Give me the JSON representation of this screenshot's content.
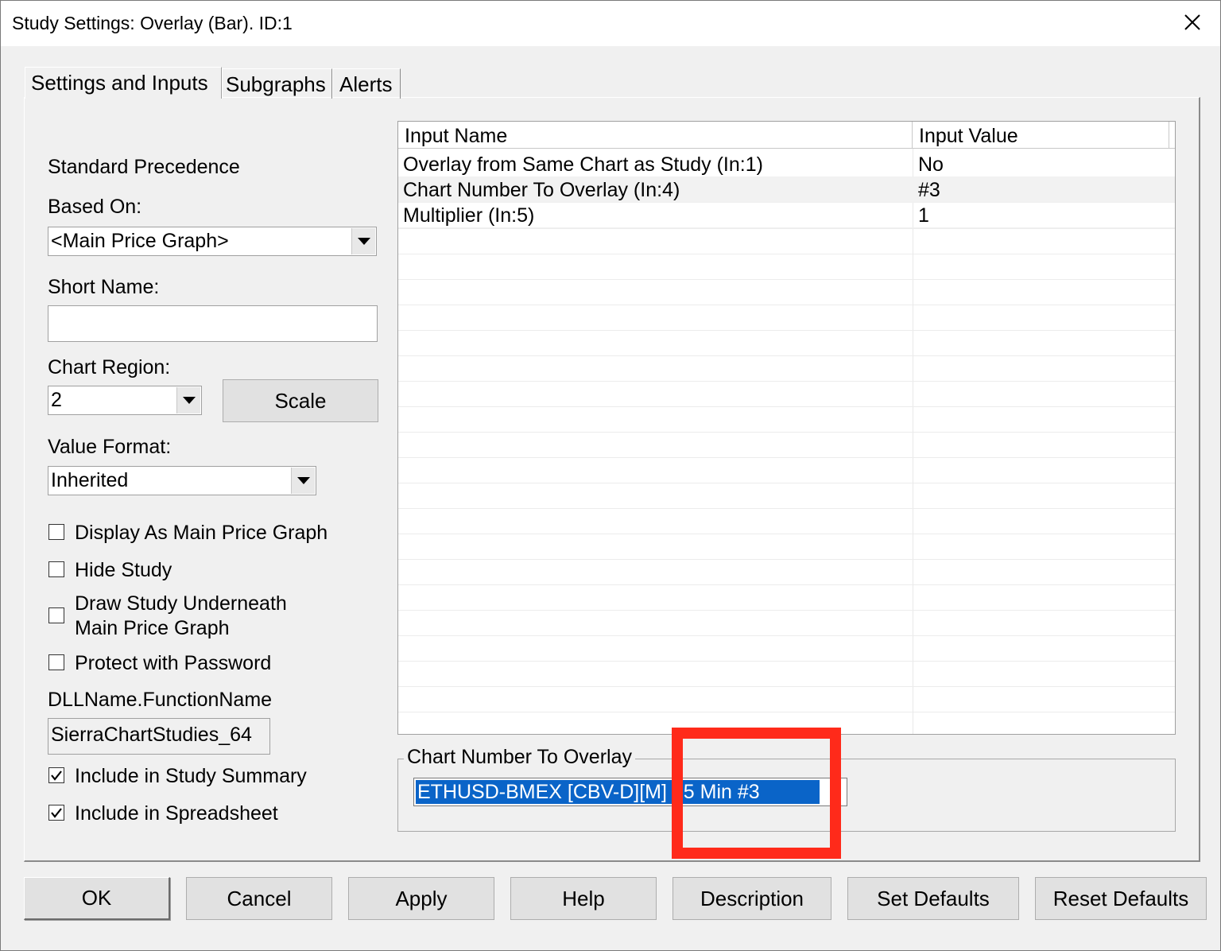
{
  "window": {
    "title": "Study Settings: Overlay (Bar). ID:1",
    "close_icon": "close-icon"
  },
  "tabs": [
    {
      "label": "Settings and Inputs",
      "active": true
    },
    {
      "label": "Subgraphs",
      "active": false
    },
    {
      "label": "Alerts",
      "active": false
    }
  ],
  "left": {
    "standard_precedence": "Standard Precedence",
    "based_on_label": "Based On:",
    "based_on_value": "<Main Price Graph>",
    "short_name_label": "Short Name:",
    "short_name_value": "",
    "chart_region_label": "Chart Region:",
    "chart_region_value": "2",
    "scale_button": "Scale",
    "value_format_label": "Value Format:",
    "value_format_value": "Inherited",
    "checkboxes": {
      "display_as_main": {
        "label": "Display As Main Price Graph",
        "checked": false
      },
      "hide_study": {
        "label": "Hide Study",
        "checked": false
      },
      "draw_underneath_line1": "Draw Study Underneath",
      "draw_underneath_line2": "Main Price Graph",
      "draw_underneath_checked": false,
      "protect_password": {
        "label": "Protect with Password",
        "checked": false
      },
      "include_summary": {
        "label": "Include in Study Summary",
        "checked": true
      },
      "include_spreadsheet": {
        "label": "Include in Spreadsheet",
        "checked": true
      }
    },
    "dll_label": "DLLName.FunctionName",
    "dll_value": "SierraChartStudies_64"
  },
  "inputs_grid": {
    "headers": {
      "name": "Input Name",
      "value": "Input Value"
    },
    "rows": [
      {
        "name": "Overlay from Same Chart as Study   (In:1)",
        "value": "No"
      },
      {
        "name": "Chart Number To Overlay   (In:4)",
        "value": "#3"
      },
      {
        "name": "Multiplier   (In:5)",
        "value": "1"
      }
    ]
  },
  "editor": {
    "group_title": "Chart Number To Overlay",
    "selected_value": "ETHUSD-BMEX [CBV-D][M]  15 Min   #3"
  },
  "buttons": {
    "ok": "OK",
    "cancel": "Cancel",
    "apply": "Apply",
    "help": "Help",
    "description": "Description",
    "set_defaults": "Set Defaults",
    "reset_defaults": "Reset Defaults"
  },
  "colors": {
    "selection": "#0a64c8",
    "highlight_box": "#ff2a1a"
  }
}
